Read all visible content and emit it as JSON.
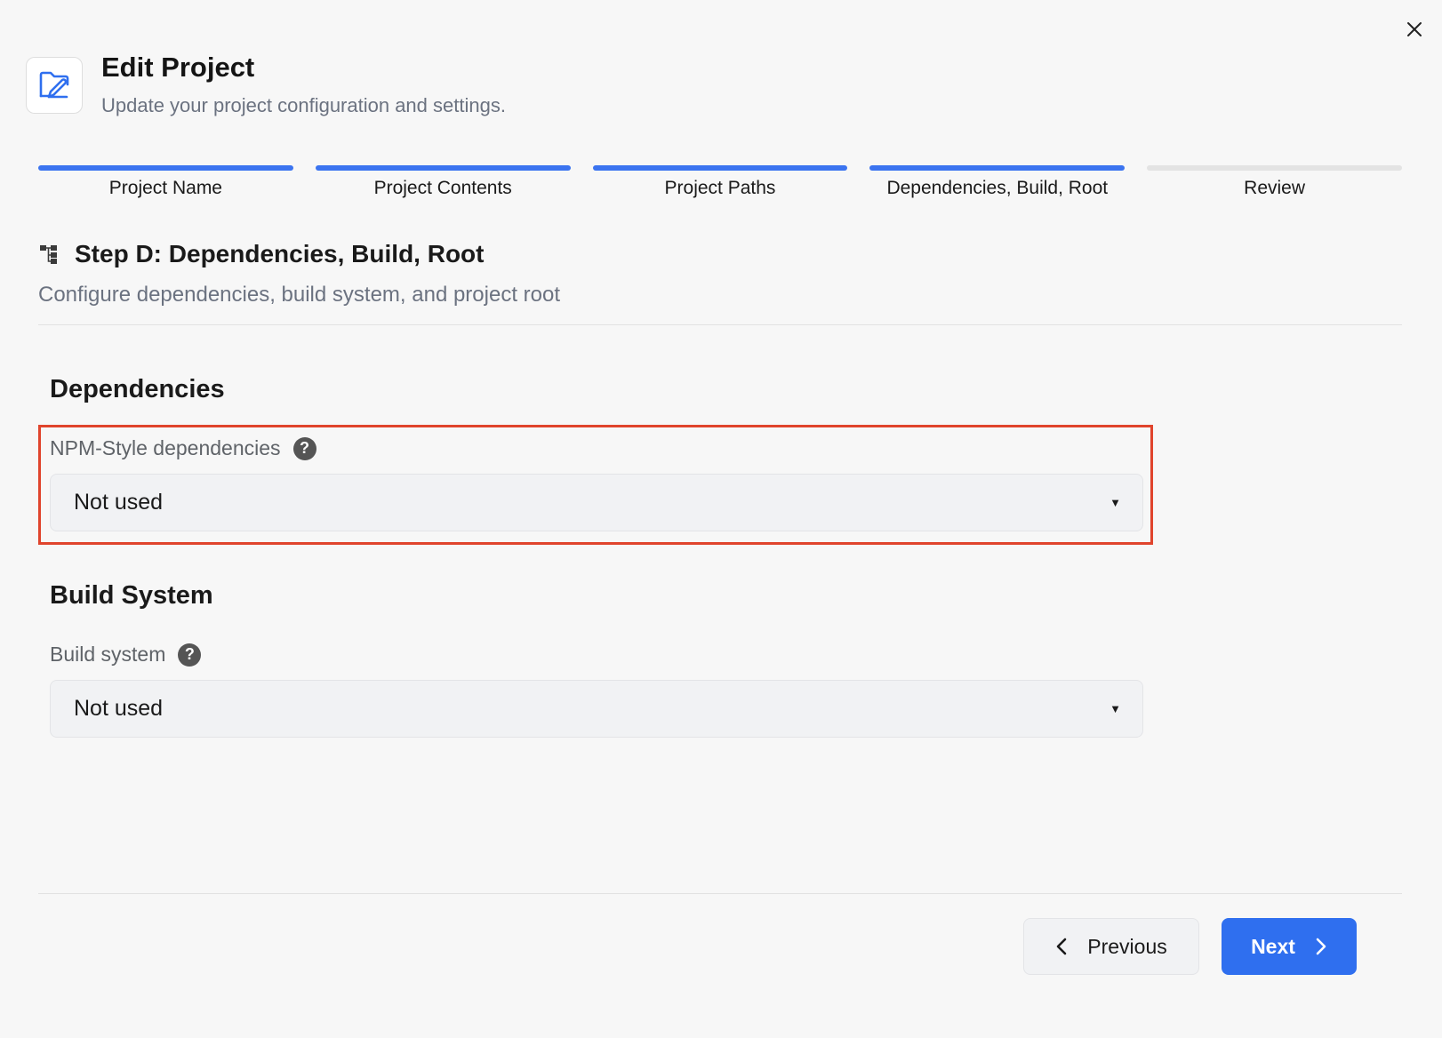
{
  "dialog": {
    "title": "Edit Project",
    "subtitle": "Update your project configuration and settings.",
    "header_icon": "folder-edit-icon",
    "close_icon": "close-icon"
  },
  "steps": [
    {
      "label": "Project Name",
      "status": "complete"
    },
    {
      "label": "Project Contents",
      "status": "complete"
    },
    {
      "label": "Project Paths",
      "status": "complete"
    },
    {
      "label": "Dependencies, Build, Root",
      "status": "active"
    },
    {
      "label": "Review",
      "status": "pending"
    }
  ],
  "section": {
    "icon": "hierarchy-icon",
    "title": "Step D: Dependencies, Build, Root",
    "description": "Configure dependencies, build system, and project root"
  },
  "dependencies": {
    "title": "Dependencies",
    "field_label": "NPM-Style dependencies",
    "value": "Not used"
  },
  "build": {
    "title": "Build System",
    "field_label": "Build system",
    "value": "Not used"
  },
  "footer": {
    "previous_label": "Previous",
    "next_label": "Next"
  },
  "colors": {
    "accent": "#2f6fef",
    "progress_complete": "#3b74f0",
    "progress_pending": "#e3e3e3",
    "highlight": "#e0442c"
  }
}
